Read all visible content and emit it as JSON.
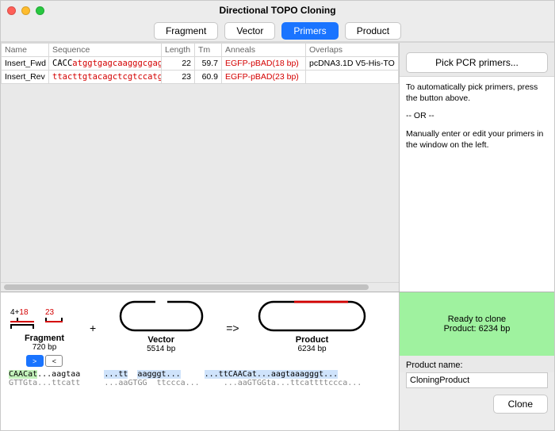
{
  "window": {
    "title": "Directional TOPO Cloning"
  },
  "tabs": {
    "fragment": "Fragment",
    "vector": "Vector",
    "primers": "Primers",
    "product": "Product"
  },
  "columns": {
    "name": "Name",
    "sequence": "Sequence",
    "length": "Length",
    "tm": "Tm",
    "anneals": "Anneals",
    "overlaps": "Overlaps"
  },
  "rows": [
    {
      "name": "Insert_Fwd",
      "seq_black": "CACC",
      "seq_red": "atggtgagcaagggcgag",
      "length": "22",
      "tm": "59.7",
      "anneals": "EGFP-pBAD(18 bp)",
      "overlaps": "pcDNA3.1D V5-His-TO"
    },
    {
      "name": "Insert_Rev",
      "seq_black": "",
      "seq_red": "ttacttgtacagctcgtccatgc",
      "length": "23",
      "tm": "60.9",
      "anneals": "EGFP-pBAD(23 bp)",
      "overlaps": ""
    }
  ],
  "side": {
    "pick": "Pick PCR primers...",
    "p1": "To automatically pick primers, press the button above.",
    "or": "-- OR --",
    "p2": "Manually enter or edit your primers in the window on the left."
  },
  "diagram": {
    "sketch_left": "4+",
    "sketch_left_red": "18",
    "sketch_right_red": "23",
    "fragment_label": "Fragment",
    "fragment_bp": "720 bp",
    "vector_label": "Vector",
    "vector_bp": "5514 bp",
    "product_label": "Product",
    "product_bp": "6234 bp",
    "plus": "+",
    "arrow": "=>",
    "chev_r": ">",
    "chev_l": "<",
    "frag_fwd_a": "CAACat",
    "frag_fwd_b": "...aagtaa",
    "frag_rev_a": "GTTGta",
    "frag_rev_b": "...ttcatt",
    "vec_fwd_a": "...tt",
    "vec_fwd_b": "aagggt...",
    "vec_rev_a": "...aaGTGG",
    "vec_rev_b": "ttccca...",
    "prod_fwd": "...ttCAACat...aagtaaagggt...",
    "prod_rev": "...aaGTGGta...ttcattttccca..."
  },
  "product": {
    "ready1": "Ready to clone",
    "ready2": "Product: 6234 bp",
    "name_label": "Product name:",
    "name_value": "CloningProduct",
    "clone": "Clone"
  }
}
